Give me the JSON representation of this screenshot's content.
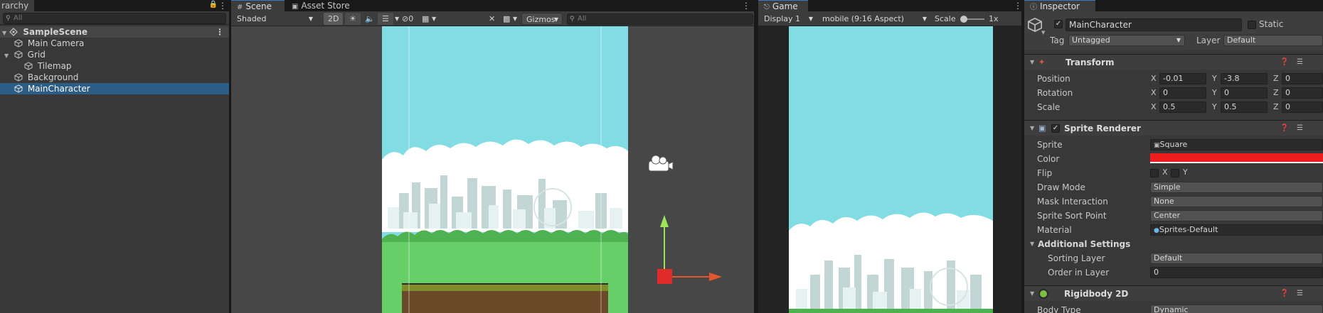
{
  "hierarchy": {
    "tab_label": "rarchy",
    "search_placeholder": "All",
    "scene_name": "SampleScene",
    "items": [
      {
        "label": "Main Camera"
      },
      {
        "label": "Grid"
      },
      {
        "label": "Tilemap"
      },
      {
        "label": "Background"
      },
      {
        "label": "MainCharacter"
      }
    ]
  },
  "scene_view": {
    "tabs": [
      {
        "label": "Scene"
      },
      {
        "label": "Asset Store"
      }
    ],
    "shading_mode": "Shaded",
    "mode_2d": "2D",
    "hidden_count": "0",
    "gizmos_label": "Gizmos",
    "search_placeholder": "All"
  },
  "game_view": {
    "tab_label": "Game",
    "display": "Display 1",
    "aspect": "mobile (9:16 Aspect)",
    "scale_label": "Scale",
    "scale_value": "1x"
  },
  "inspector": {
    "tab_label": "Inspector",
    "object_name": "MainCharacter",
    "static_label": "Static",
    "tag_label": "Tag",
    "tag_value": "Untagged",
    "layer_label": "Layer",
    "layer_value": "Default",
    "transform": {
      "title": "Transform",
      "position_label": "Position",
      "rotation_label": "Rotation",
      "scale_label": "Scale",
      "position": {
        "x": "-0.01",
        "y": "-3.8",
        "z": "0"
      },
      "rotation": {
        "x": "0",
        "y": "0",
        "z": "0"
      },
      "scale": {
        "x": "0.5",
        "y": "0.5",
        "z": "0"
      }
    },
    "sprite_renderer": {
      "title": "Sprite Renderer",
      "sprite_label": "Sprite",
      "sprite_value": "Square",
      "color_label": "Color",
      "color_value": "#ee1c1c",
      "flip_label": "Flip",
      "flip_x": "X",
      "flip_y": "Y",
      "draw_mode_label": "Draw Mode",
      "draw_mode_value": "Simple",
      "mask_label": "Mask Interaction",
      "mask_value": "None",
      "sort_point_label": "Sprite Sort Point",
      "sort_point_value": "Center",
      "material_label": "Material",
      "material_value": "Sprites-Default",
      "additional_label": "Additional Settings",
      "sorting_layer_label": "Sorting Layer",
      "sorting_layer_value": "Default",
      "order_label": "Order in Layer",
      "order_value": "0"
    },
    "rigidbody": {
      "title": "Rigidbody 2D",
      "body_type_label": "Body Type",
      "body_type_value": "Dynamic"
    }
  },
  "colors": {
    "selection": "#2c5d87",
    "sky": "#82dce4",
    "grass": "#66cf68",
    "dirt": "#6b4a2a",
    "character": "#e12b2b"
  }
}
